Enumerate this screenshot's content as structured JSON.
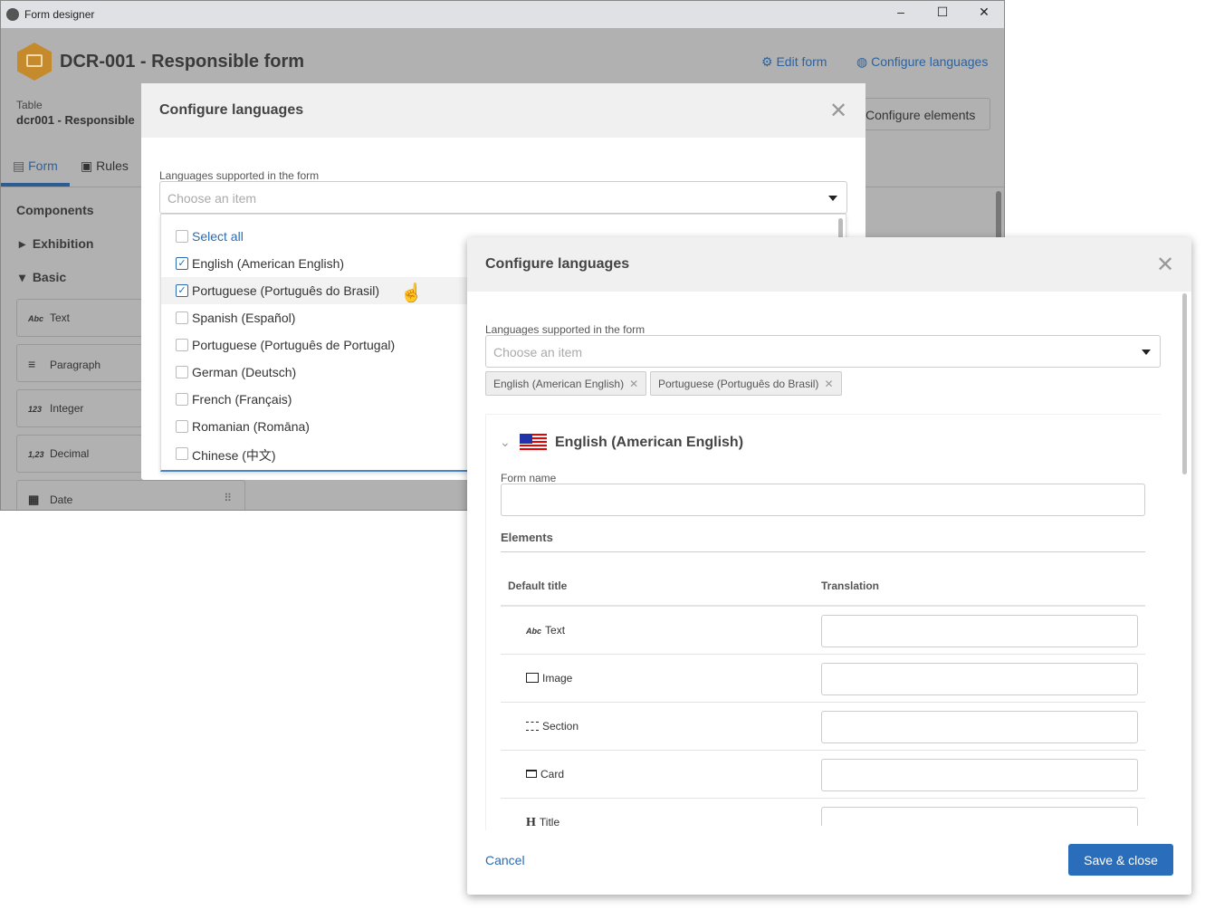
{
  "window": {
    "title": "Form designer",
    "minimize": "–",
    "maximize": "☐",
    "close": "✕"
  },
  "header": {
    "title": "DCR-001 - Responsible form",
    "edit_form": "Edit form",
    "configure_languages": "Configure languages",
    "configure_elements": "Configure elements"
  },
  "table": {
    "label": "Table",
    "value": "dcr001 - Responsible"
  },
  "tabs": [
    {
      "label": "Form",
      "active": true
    },
    {
      "label": "Rules",
      "active": false
    }
  ],
  "sidebar": {
    "heading": "Components",
    "groups": [
      {
        "label": "Exhibition",
        "expanded": false
      },
      {
        "label": "Basic",
        "expanded": true
      }
    ],
    "components": [
      {
        "icon": "Abc",
        "label": "Text"
      },
      {
        "icon": "≡",
        "label": "Paragraph"
      },
      {
        "icon": "123",
        "label": "Integer"
      },
      {
        "icon": "1,23",
        "label": "Decimal"
      },
      {
        "icon": "calendar-icon",
        "label": "Date"
      }
    ]
  },
  "modal1": {
    "title": "Configure languages",
    "field_label": "Languages supported in the form",
    "placeholder": "Choose an item",
    "select_all": "Select all",
    "options": [
      {
        "label": "English (American English)",
        "checked": true
      },
      {
        "label": "Portuguese (Português do Brasil)",
        "checked": true
      },
      {
        "label": "Spanish (Español)",
        "checked": false
      },
      {
        "label": "Portuguese (Português de Portugal)",
        "checked": false
      },
      {
        "label": "German (Deutsch)",
        "checked": false
      },
      {
        "label": "French (Français)",
        "checked": false
      },
      {
        "label": "Romanian (Romāna)",
        "checked": false
      },
      {
        "label": "Chinese (中文)",
        "checked": false
      }
    ]
  },
  "modal2": {
    "title": "Configure languages",
    "field_label": "Languages supported in the form",
    "placeholder": "Choose an item",
    "tags": [
      "English (American English)",
      "Portuguese (Português do Brasil)"
    ],
    "section": {
      "title": "English (American English)",
      "form_name_label": "Form name",
      "form_name_value": "",
      "elements_heading": "Elements",
      "col_default": "Default title",
      "col_translation": "Translation",
      "rows": [
        {
          "icon": "Abc",
          "label": "Text"
        },
        {
          "icon": "image-icon",
          "label": "Image"
        },
        {
          "icon": "section-icon",
          "label": "Section"
        },
        {
          "icon": "card-icon",
          "label": "Card"
        },
        {
          "icon": "H",
          "label": "Title"
        }
      ]
    },
    "cancel": "Cancel",
    "save": "Save & close"
  },
  "colors": {
    "accent": "#2b6cb0",
    "primary_button": "#2a6ebb",
    "overlay": "#b1b1b1"
  }
}
